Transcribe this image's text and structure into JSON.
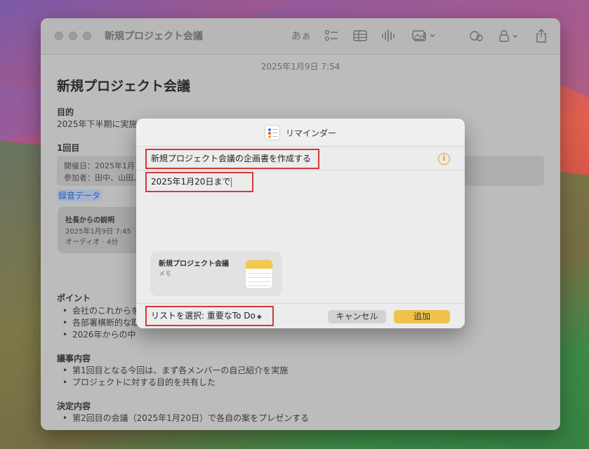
{
  "window": {
    "title": "新規プロジェクト会議",
    "toolbar_format_label": "あぁ"
  },
  "note": {
    "date": "2025年1月9日 7:54",
    "title": "新規プロジェクト会議",
    "purpose_heading": "目的",
    "purpose_text": "2025年下半期に実施",
    "first_heading": "1回目",
    "meeting_date": "開催日：2025年1月",
    "participants": "参加者：田中、山田、",
    "recording_link": "録音データ",
    "recording_card": {
      "title": "社長からの説明",
      "date": "2025年1月9日 7:45",
      "meta": "オーディオ · 4分"
    },
    "points_heading": "ポイント",
    "points": [
      "会社のこれからを",
      "各部署横断的な取",
      "2026年からの中"
    ],
    "agenda_heading": "議事内容",
    "agenda": [
      "第1回目となる今回は、まず各メンバーの自己紹介を実施",
      "プロジェクトに対する目的を共有した"
    ],
    "decision_heading": "決定内容",
    "decisions": [
      "第2回目の会議（2025年1月20日）で各自の案をプレゼンする"
    ]
  },
  "dialog": {
    "title": "リマインダー",
    "reminder_title": "新規プロジェクト会議の企画書を作成する",
    "reminder_notes": "2025年1月20日まで",
    "attachment": {
      "name": "新規プロジェクト会議",
      "type": "メモ"
    },
    "list_select": "リストを選択: 重要なTo Do",
    "cancel_label": "キャンセル",
    "add_label": "追加"
  },
  "colors": {
    "highlight_border": "#d23a3a",
    "add_button": "#eec24b",
    "info_icon": "#e3a21a"
  }
}
